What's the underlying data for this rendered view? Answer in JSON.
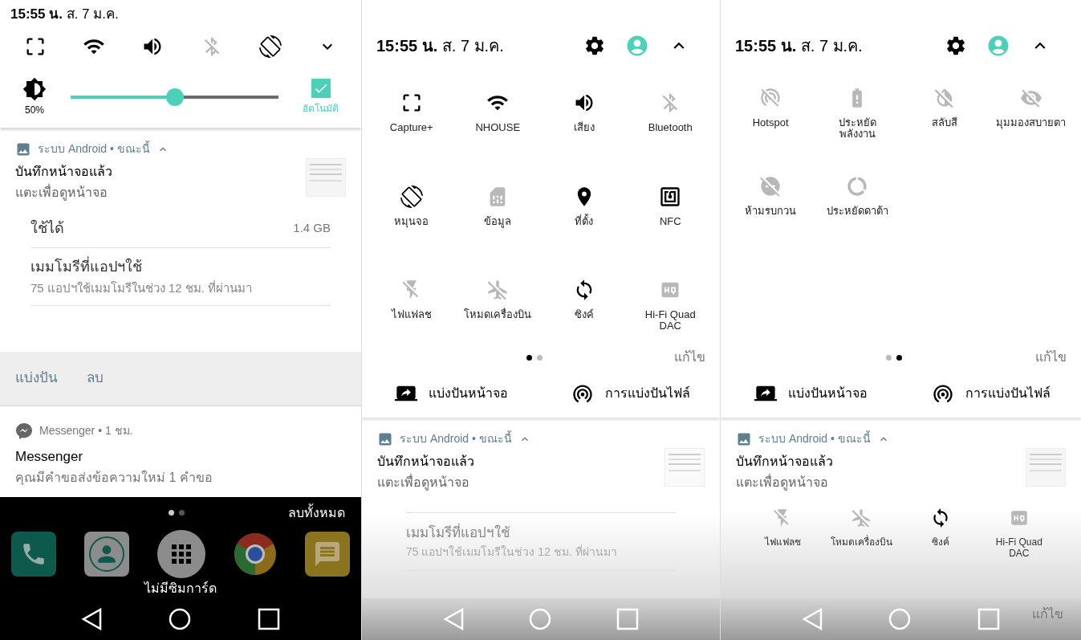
{
  "compact_shade": {
    "status_time": "**15:55 น.** ส. 7 ม.ค.",
    "quick_toggles": [
      {
        "kind": "capture",
        "on": true
      },
      {
        "kind": "wifi",
        "on": true
      },
      {
        "kind": "sound",
        "on": true
      },
      {
        "kind": "bluetooth",
        "on": false
      },
      {
        "kind": "rotate",
        "on": true
      }
    ],
    "brightness": {
      "reading": "50%",
      "level": 0.5,
      "auto_checked": true,
      "auto_label": "อัตโนมัติ"
    },
    "notification": {
      "header": "ระบบ Android • ขณะนี้",
      "title": "บันทึกหน้าจอแล้ว",
      "text": "แตะเพื่อดูหน้าจอ"
    },
    "memory_rows": [
      {
        "title": "ใช้ได้",
        "value": "1.4 GB"
      },
      {
        "title": "เมมโมรีที่แอปฯใช้",
        "subtitle": "75 แอปฯใช้เมมโมรีในช่วง 12 ชม. ที่ผ่านมา"
      }
    ],
    "actions": [
      "แบ่งปัน",
      "ลบ"
    ],
    "messenger": {
      "header": "Messenger • 1 ชม.",
      "title": "Messenger",
      "text": "คุณมีคำขอส่งข้อความใหม่ 1 คำขอ"
    },
    "home": {
      "page_dots": [
        {
          "selected": true
        },
        {
          "selected": false
        }
      ],
      "clear_all": "ลบทั้งหมด",
      "dock": [
        {
          "kind": "phone"
        },
        {
          "kind": "contacts"
        },
        {
          "kind": "apps"
        },
        {
          "kind": "browser"
        },
        {
          "kind": "messages"
        }
      ],
      "sim_status": "ไม่มีซิมการ์ด"
    }
  },
  "expanded_page_1": {
    "status_time": "**15:55 น.** ส. 7 ม.ค.",
    "tiles": [
      {
        "kind": "capture",
        "label": "Capture+",
        "on": true
      },
      {
        "kind": "wifi",
        "label": "NHOUSE",
        "on": true
      },
      {
        "kind": "sound",
        "label": "เสียง",
        "on": true
      },
      {
        "kind": "bluetooth",
        "label": "Bluetooth",
        "on": false
      },
      {
        "kind": "rotate",
        "label": "หมุนจอ",
        "on": true
      },
      {
        "kind": "sim",
        "label": "ข้อมูล",
        "on": false
      },
      {
        "kind": "location",
        "label": "ที่ตั้ง",
        "on": true
      },
      {
        "kind": "nfc",
        "label": "NFC",
        "on": true
      },
      {
        "kind": "flash",
        "label": "ไฟแฟลช",
        "on": false
      },
      {
        "kind": "airplane",
        "label": "โหมดเครื่องบิน",
        "on": false
      },
      {
        "kind": "sync",
        "label": "ซิงค์",
        "on": true
      },
      {
        "kind": "hifi",
        "label": "Hi-Fi Quad\nDAC",
        "on": false
      }
    ],
    "page_dots": [
      {
        "selected": true
      },
      {
        "selected": false
      }
    ],
    "edit": "แก้ไข",
    "share_buttons": [
      {
        "kind": "screen",
        "label": "แบ่งปันหน้าจอ"
      },
      {
        "kind": "file",
        "label": "การแบ่งปันไฟล์"
      }
    ],
    "notification": {
      "header": "ระบบ Android • ขณะนี้",
      "title": "บันทึกหน้าจอแล้ว",
      "text": "แตะเพื่อดูหน้าจอ"
    },
    "memory_row": {
      "title": "เมมโมรีที่แอปฯใช้",
      "subtitle": "75 แอปฯใช้เมมโมรีในช่วง 12 ชม. ที่ผ่านมา"
    }
  },
  "expanded_page_2": {
    "status_time": "**15:55 น.** ส. 7 ม.ค.",
    "tiles": [
      {
        "kind": "hotspot",
        "label": "Hotspot",
        "on": false
      },
      {
        "kind": "battery",
        "label": "ประหยัด\nพลังงาน",
        "on": false
      },
      {
        "kind": "invert",
        "label": "สลับสี",
        "on": false
      },
      {
        "kind": "eye",
        "label": "มุมมองสบายตา",
        "on": false
      },
      {
        "kind": "dnd",
        "label": "ห้ามรบกวน",
        "on": false
      },
      {
        "kind": "datasaver",
        "label": "ประหยัดดาต้า",
        "on": false
      }
    ],
    "page_dots": [
      {
        "selected": false
      },
      {
        "selected": true
      }
    ],
    "edit": "แก้ไข",
    "share_buttons": [
      {
        "kind": "screen",
        "label": "แบ่งปันหน้าจอ"
      },
      {
        "kind": "file",
        "label": "การแบ่งปันไฟล์"
      }
    ],
    "notification": {
      "header": "ระบบ Android • ขณะนี้",
      "title": "บันทึกหน้าจอแล้ว",
      "text": "แตะเพื่อดูหน้าจอ"
    },
    "faded_tiles": [
      {
        "kind": "flash",
        "label": "ไฟแฟลช",
        "on": false
      },
      {
        "kind": "airplane",
        "label": "โหมดเครื่องบิน",
        "on": false
      },
      {
        "kind": "sync",
        "label": "ซิงค์",
        "on": true
      },
      {
        "kind": "hifi",
        "label": "Hi-Fi Quad\nDAC",
        "on": false
      }
    ],
    "faded_edit": "แก้ไข"
  }
}
